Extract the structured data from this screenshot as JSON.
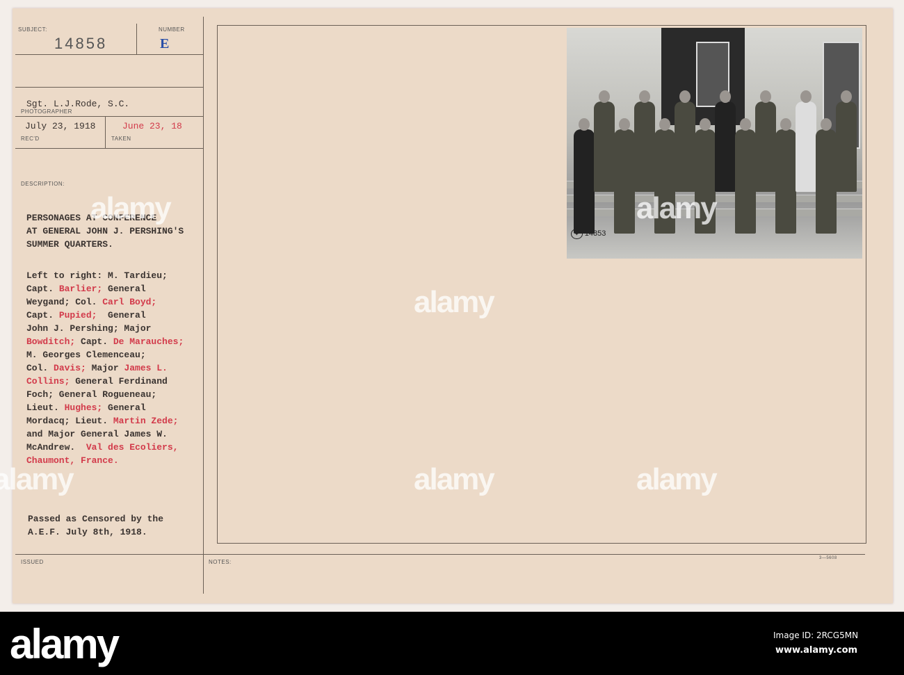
{
  "card": {
    "subject_label": "SUBJECT:",
    "number_label": "NUMBER",
    "subject_value": "14858",
    "number_value": "E",
    "photographer": "Sgt. L.J.Rode, S.C.",
    "photographer_label": "PHOTOGRAPHER",
    "received": "July 23, 1918",
    "received_label": "REC'D",
    "taken": "June 23, 18",
    "taken_label": "TAKEN",
    "description_label": "DESCRIPTION:",
    "title_lines": [
      "PERSONAGES AT CONFERENCE",
      "AT GENERAL JOHN J. PERSHING'S",
      "SUMMER QUARTERS."
    ],
    "description_lines": [
      [
        {
          "t": "Left to right: M. Tardieu;",
          "r": false
        }
      ],
      [
        {
          "t": "Capt. ",
          "r": false
        },
        {
          "t": "Barlier;",
          "r": true
        },
        {
          "t": " General",
          "r": false
        }
      ],
      [
        {
          "t": "Weygand; Col. ",
          "r": false
        },
        {
          "t": "Carl Boyd;",
          "r": true
        }
      ],
      [
        {
          "t": "Capt. ",
          "r": false
        },
        {
          "t": "Pupied;",
          "r": true
        },
        {
          "t": "  General",
          "r": false
        }
      ],
      [
        {
          "t": "John J. Pershing; Major",
          "r": false
        }
      ],
      [
        {
          "t": "Bowditch;",
          "r": true
        },
        {
          "t": " Capt. ",
          "r": false
        },
        {
          "t": "De Marauches;",
          "r": true
        }
      ],
      [
        {
          "t": "M. Georges Clemenceau;",
          "r": false
        }
      ],
      [
        {
          "t": "Col. ",
          "r": false
        },
        {
          "t": "Davis;",
          "r": true
        },
        {
          "t": " Major ",
          "r": false
        },
        {
          "t": "James L.",
          "r": true
        }
      ],
      [
        {
          "t": "Collins;",
          "r": true
        },
        {
          "t": " General Ferdinand",
          "r": false
        }
      ],
      [
        {
          "t": "Foch; General Rogueneau;",
          "r": false
        }
      ],
      [
        {
          "t": "Lieut. ",
          "r": false
        },
        {
          "t": "Hughes;",
          "r": true
        },
        {
          "t": " General",
          "r": false
        }
      ],
      [
        {
          "t": "Mordacq; Lieut. ",
          "r": false
        },
        {
          "t": "Martin Zede;",
          "r": true
        }
      ],
      [
        {
          "t": "and Major General James W.",
          "r": false
        }
      ],
      [
        {
          "t": "McAndrew.  ",
          "r": false
        },
        {
          "t": "Val des Ecoliers,",
          "r": true
        }
      ],
      [
        {
          "t": "Chaumont, France.",
          "r": true
        }
      ]
    ],
    "censor_lines": [
      "Passed as Censored by the",
      "A.E.F. July 8th, 1918."
    ],
    "issued_label": "ISSUED",
    "notes_label": "NOTES:",
    "form_number": "3—5608",
    "photo_stamp_number": "14853",
    "photo_stamp_seal": "SIGNAL CORPS USA"
  },
  "watermark": "alamy",
  "footer": {
    "logo": "alamy",
    "image_id": "Image ID: 2RCG5MN",
    "url": "www.alamy.com"
  },
  "colors": {
    "red_ink": "#d23a4a",
    "blue_ink": "#2a4fa8",
    "paper": "#ecdac8"
  }
}
